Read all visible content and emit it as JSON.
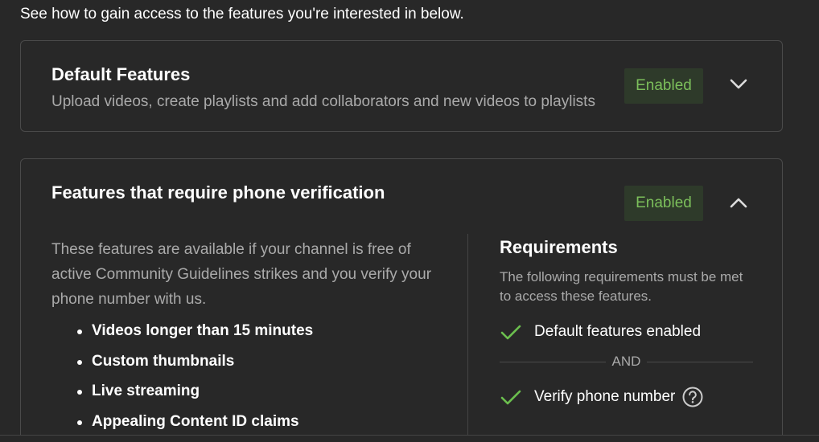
{
  "intro": "See how to gain access to the features you're interested in below.",
  "cards": [
    {
      "title": "Default Features",
      "description": "Upload videos, create playlists and add collaborators and new videos to playlists",
      "status": "Enabled",
      "chevron": "chevron-down"
    },
    {
      "title": "Features that require phone verification",
      "status": "Enabled",
      "chevron": "chevron-up",
      "description": "These features are available if your channel is free of active Community Guidelines strikes and you verify your phone number with us.",
      "features": [
        "Videos longer than 15 minutes",
        "Custom thumbnails",
        "Live streaming",
        "Appealing Content ID claims"
      ],
      "requirements": {
        "title": "Requirements",
        "description": "The following requirements must be met to access these features.",
        "items": [
          {
            "label": "Default features enabled",
            "icon": "check-icon"
          },
          {
            "label": "Verify phone number",
            "icon": "check-icon",
            "help_icon": "help-circle-icon"
          }
        ],
        "separator": "AND"
      }
    }
  ],
  "colors": {
    "background": "#282828",
    "enabled_text": "#7cbf5b",
    "enabled_bg": "#2e3a2a",
    "check": "#6bbf4e",
    "muted_text": "#aaaaaa"
  }
}
